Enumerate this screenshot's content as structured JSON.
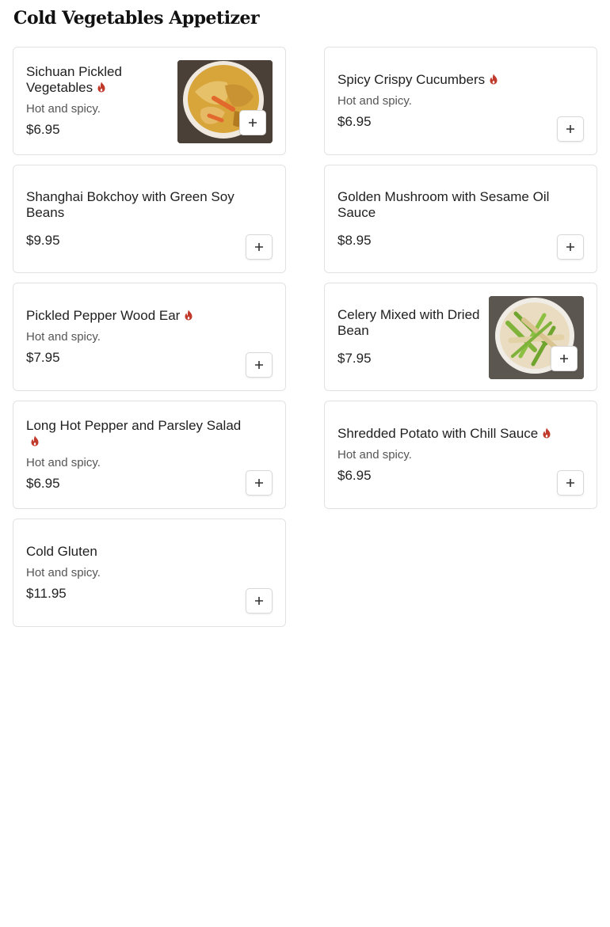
{
  "section": {
    "title": "Cold Vegetables Appetizer"
  },
  "items": [
    {
      "name": "Sichuan Pickled Vegetables",
      "spicy": true,
      "desc": "Hot and spicy.",
      "price": "$6.95",
      "image": "pickled-vegetables-photo"
    },
    {
      "name": "Spicy Crispy Cucumbers",
      "spicy": true,
      "desc": "Hot and spicy.",
      "price": "$6.95"
    },
    {
      "name": "Shanghai Bokchoy with Green Soy Beans",
      "spicy": false,
      "desc": "",
      "price": "$9.95"
    },
    {
      "name": "Golden Mushroom with Sesame Oil Sauce",
      "spicy": false,
      "desc": "",
      "price": "$8.95"
    },
    {
      "name": "Pickled Pepper Wood Ear",
      "spicy": true,
      "desc": "Hot and spicy.",
      "price": "$7.95"
    },
    {
      "name": "Celery Mixed with Dried Bean",
      "spicy": false,
      "desc": "",
      "price": "$7.95",
      "image": "celery-dried-bean-photo"
    },
    {
      "name": "Long Hot Pepper and Parsley Salad",
      "spicy": true,
      "desc": "Hot and spicy.",
      "price": "$6.95"
    },
    {
      "name": "Shredded Potato with Chill Sauce",
      "spicy": true,
      "desc": "Hot and spicy.",
      "price": "$6.95"
    },
    {
      "name": "Cold Gluten",
      "spicy": false,
      "desc": "Hot and spicy.",
      "price": "$11.95"
    }
  ],
  "icons": {
    "spicy": "flame-icon",
    "add": "plus-icon"
  },
  "colors": {
    "spicy": "#c0392b",
    "border": "#e2e2e2"
  }
}
